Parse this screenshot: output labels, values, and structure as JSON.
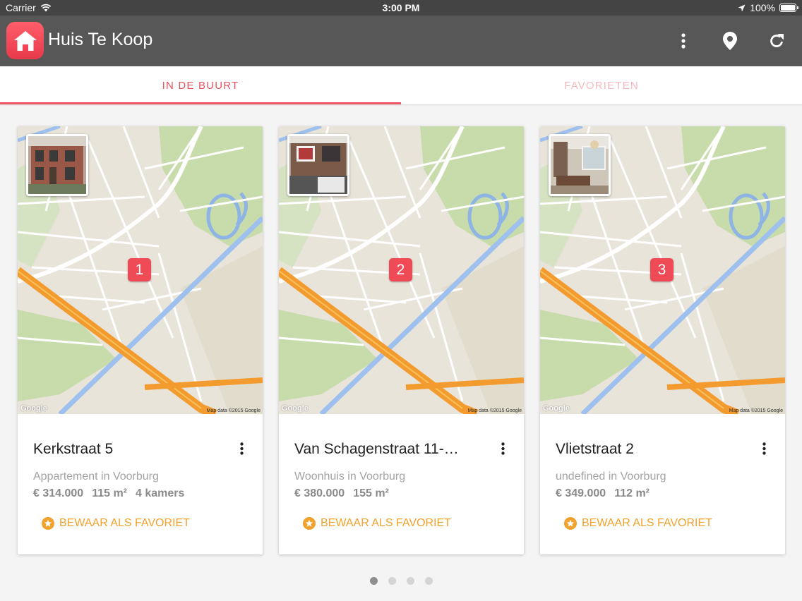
{
  "status_bar": {
    "carrier": "Carrier",
    "time": "3:00 PM",
    "battery": "100%"
  },
  "app_bar": {
    "title": "Huis Te Koop"
  },
  "tabs": [
    {
      "label": "IN DE BUURT",
      "active": true
    },
    {
      "label": "FAVORIETEN",
      "active": false
    }
  ],
  "cards": [
    {
      "marker": "1",
      "title": "Kerkstraat 5",
      "type": "Appartement in Voorburg",
      "price": "€ 314.000",
      "area": "115 m²",
      "rooms": "4 kamers",
      "fav_label": "BEWAAR ALS FAVORIET",
      "map_credit": "Map data ©2015 Google",
      "map_logo": "Google"
    },
    {
      "marker": "2",
      "title": "Van Schagenstraat 11-…",
      "type": "Woonhuis in Voorburg",
      "price": "€ 380.000",
      "area": "155 m²",
      "rooms": "",
      "fav_label": "BEWAAR ALS FAVORIET",
      "map_credit": "Map data ©2015 Google",
      "map_logo": "Google"
    },
    {
      "marker": "3",
      "title": "Vlietstraat 2",
      "type": "undefined in Voorburg",
      "price": "€ 349.000",
      "area": "112 m²",
      "rooms": "",
      "fav_label": "BEWAAR ALS FAVORIET",
      "map_credit": "Map data ©2015 Google",
      "map_logo": "Google"
    }
  ],
  "pager": {
    "count": 4,
    "active_index": 0
  },
  "colors": {
    "accent": "#e9545f",
    "favorite": "#f2a12c",
    "app_bar": "#575757"
  }
}
